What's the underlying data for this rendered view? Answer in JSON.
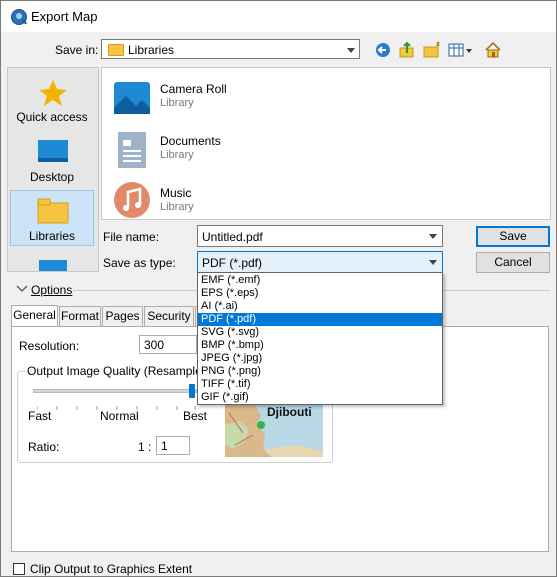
{
  "window": {
    "title": "Export Map"
  },
  "save_in": {
    "label": "Save in:",
    "value": "Libraries"
  },
  "places": [
    {
      "label": "Quick access"
    },
    {
      "label": "Desktop"
    },
    {
      "label": "Libraries"
    }
  ],
  "files": [
    {
      "name": "Camera Roll",
      "type": "Library"
    },
    {
      "name": "Documents",
      "type": "Library"
    },
    {
      "name": "Music",
      "type": "Library"
    }
  ],
  "file_name": {
    "label": "File name:",
    "value": "Untitled.pdf"
  },
  "save_type": {
    "label": "Save as type:",
    "value": "PDF (*.pdf)"
  },
  "buttons": {
    "save": "Save",
    "cancel": "Cancel"
  },
  "type_options": [
    "EMF (*.emf)",
    "EPS (*.eps)",
    "AI (*.ai)",
    "PDF (*.pdf)",
    "SVG (*.svg)",
    "BMP (*.bmp)",
    "JPEG (*.jpg)",
    "PNG (*.png)",
    "TIFF (*.tif)",
    "GIF (*.gif)"
  ],
  "selected_type_index": 3,
  "options": {
    "label": "Options"
  },
  "tabs": [
    "General",
    "Format",
    "Pages",
    "Security"
  ],
  "general": {
    "resolution_label": "Resolution:",
    "resolution_value": "300",
    "quality_label": "Output Image Quality (Resample Ra",
    "quality_fraction": 1.0,
    "fast": "Fast",
    "normal": "Normal",
    "best": "Best",
    "ratio_label": "Ratio:",
    "ratio_prefix": "1 :",
    "ratio_value": "1",
    "map_label": "Djibouti"
  },
  "clip_output": {
    "label": "Clip Output to Graphics Extent",
    "checked": false
  },
  "colors": {
    "accent": "#0078d7",
    "selection": "#cce4f7",
    "folder": "#f5c542"
  }
}
